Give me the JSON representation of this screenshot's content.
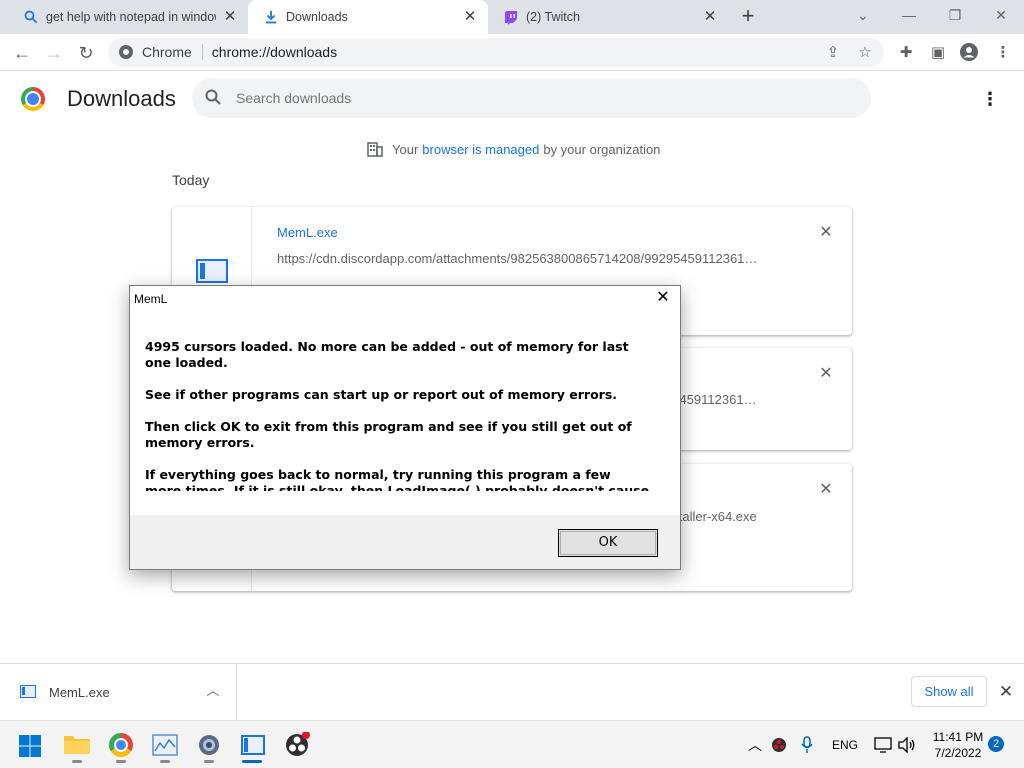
{
  "tabs": [
    {
      "title": "get help with notepad in windows",
      "icon": "search-icon"
    },
    {
      "title": "Downloads",
      "icon": "download-icon"
    },
    {
      "title": "(2) Twitch",
      "icon": "twitch-icon"
    }
  ],
  "omnibox": {
    "chip": "Chrome",
    "url": "chrome://downloads"
  },
  "page": {
    "title": "Downloads",
    "search_placeholder": "Search downloads",
    "managed_prefix": "Your",
    "managed_link": "browser is managed",
    "managed_suffix": "by your organization",
    "section": "Today"
  },
  "downloads": [
    {
      "name": "MemL.exe",
      "url": "https://cdn.discordapp.com/attachments/982563800865714208/99295459112361…"
    },
    {
      "name": "",
      "url": "…95459112361…"
    },
    {
      "name": "",
      "url": "…nstaller-x64.exe"
    }
  ],
  "dialog": {
    "title": "MemL",
    "paragraphs": [
      "4995 cursors loaded. No more can be added - out of memory for last one loaded.",
      "See if other programs can start up or report out of memory errors.",
      "Then click OK to exit from this program and see if you still get out of memory errors.",
      "If everything goes back to normal, try running this program a few more times. If it is still okay, then LoadImage( ) probably doesn't cause a leak on"
    ],
    "ok_label": "OK"
  },
  "download_bar": {
    "file": "MemL.exe",
    "show_all": "Show all"
  },
  "taskbar": {
    "language": "ENG",
    "time": "11:41 PM",
    "date": "7/2/2022",
    "notifications": "2"
  },
  "colors": {
    "accent": "#1a73e8",
    "tab_strip": "#dee1e6",
    "taskbar_accent": "#0067c0"
  }
}
